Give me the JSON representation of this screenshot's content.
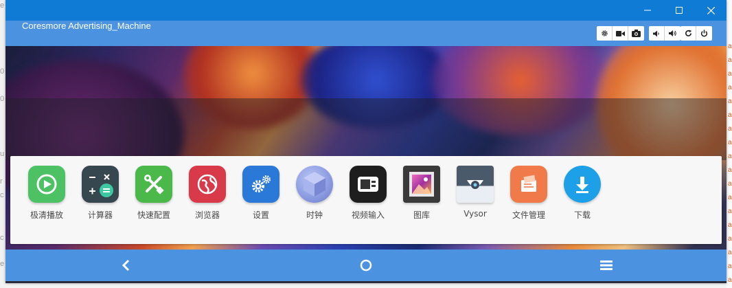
{
  "window": {
    "title_bar_color": "#0f7bd4",
    "controls": [
      "minimize-icon",
      "maximize-icon",
      "close-icon"
    ]
  },
  "toolbar": {
    "title": "Coresmore Advertising_Machine",
    "buttons": [
      "settings-icon",
      "record-video-icon",
      "screenshot-icon",
      "volume-down-icon",
      "volume-up-icon",
      "rotate-icon",
      "power-icon"
    ],
    "bar_color": "#4b93e0"
  },
  "launcher": {
    "apps": [
      {
        "label": "极清播放",
        "icon": "video-player-icon",
        "color": "#4cc264"
      },
      {
        "label": "计算器",
        "icon": "calculator-icon",
        "color": "#37474f"
      },
      {
        "label": "快速配置",
        "icon": "tools-icon",
        "color": "#4bb84a"
      },
      {
        "label": "浏览器",
        "icon": "browser-icon",
        "color": "#d83a4a"
      },
      {
        "label": "设置",
        "icon": "settings-gears-icon",
        "color": "#2a78d8"
      },
      {
        "label": "时钟",
        "icon": "clock-icon",
        "color": "#8a9ae0"
      },
      {
        "label": "视频输入",
        "icon": "video-input-icon",
        "color": "#1e1e1e"
      },
      {
        "label": "图库",
        "icon": "gallery-icon",
        "color": "#6a2a6a"
      },
      {
        "label": "Vysor",
        "icon": "vysor-icon",
        "color": "#3a4a5a"
      },
      {
        "label": "文件管理",
        "icon": "file-manager-icon",
        "color": "#f07a4a"
      },
      {
        "label": "下载",
        "icon": "download-icon",
        "color": "#1ea0e8"
      }
    ]
  },
  "navigation": {
    "buttons": [
      "back-icon",
      "home-icon",
      "menu-icon"
    ]
  },
  "background_page": {
    "left_fragments": [
      "e",
      "0",
      "0",
      "u",
      "r",
      "c",
      "d",
      "c",
      "e"
    ],
    "right_fragments": [
      "a",
      "a",
      "a",
      "a",
      "a",
      "a",
      "a",
      "a",
      "a",
      "a",
      "a",
      "a",
      "a",
      "a",
      "a",
      "a",
      "a",
      "a",
      "a"
    ]
  }
}
